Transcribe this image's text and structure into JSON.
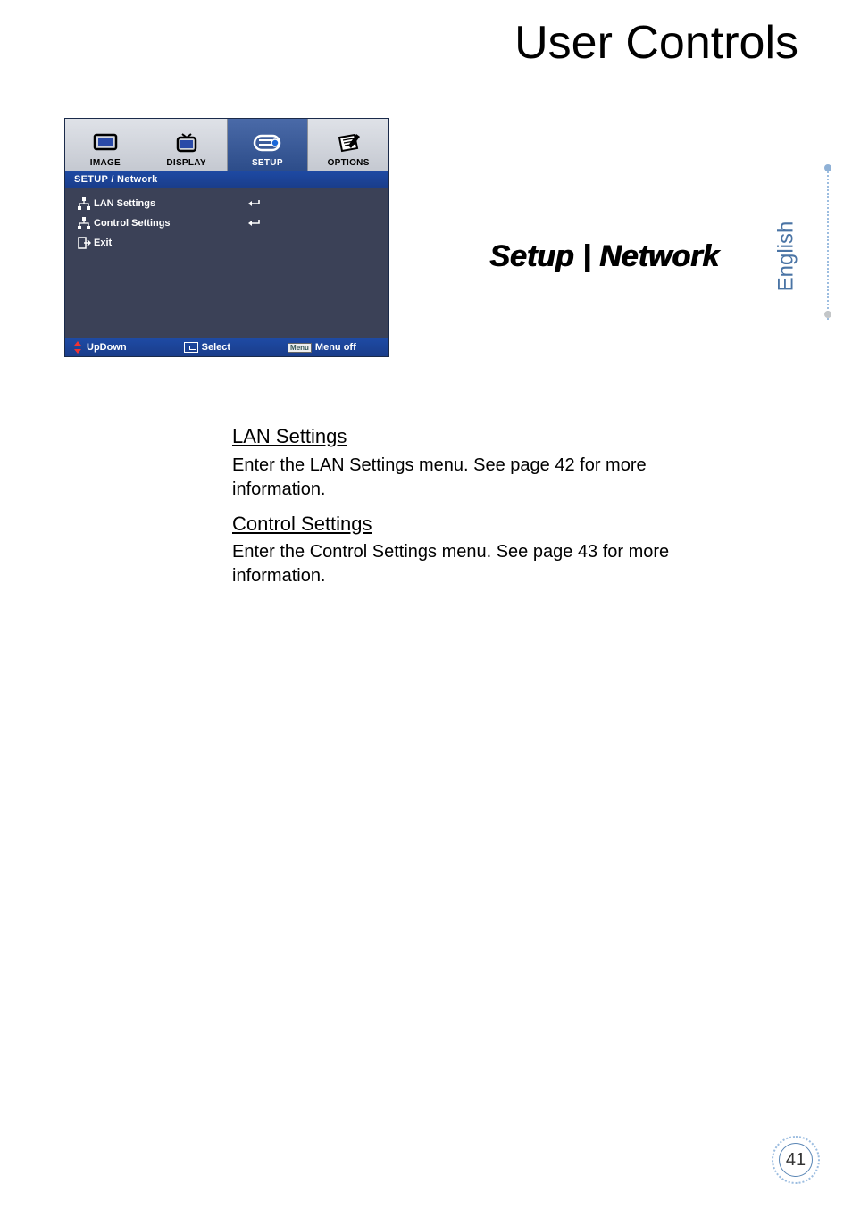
{
  "page": {
    "title": "User Controls",
    "section_title": "Setup | Network",
    "language": "English",
    "page_number": "41"
  },
  "osd": {
    "tabs": {
      "image": "IMAGE",
      "display": "DISPLAY",
      "setup": "SETUP",
      "options": "OPTIONS"
    },
    "breadcrumb": "SETUP / Network",
    "rows": {
      "lan_settings": "LAN Settings",
      "control_settings": "Control Settings",
      "exit": "Exit"
    },
    "footer": {
      "updown": "UpDown",
      "select": "Select",
      "menu_key": "Menu",
      "menu_off": "Menu off"
    }
  },
  "content": {
    "lan_heading": "LAN Settings",
    "lan_body": "Enter the LAN Settings menu. See page 42 for more information.",
    "control_heading": "Control Settings",
    "control_body": "Enter the Control Settings menu. See page 43 for more information."
  }
}
